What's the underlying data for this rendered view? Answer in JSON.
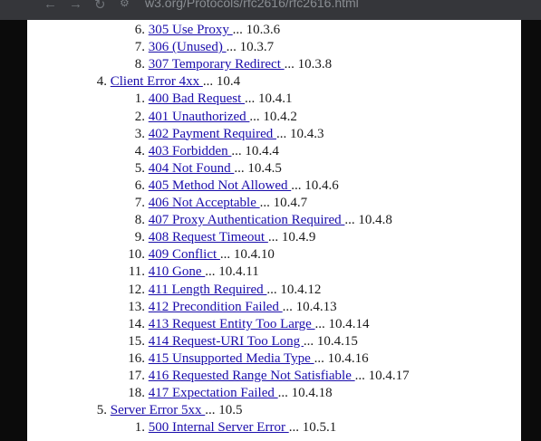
{
  "browser": {
    "url": "w3.org/Protocols/rfc2616/rfc2616.html",
    "back_icon": "←",
    "forward_icon": "→",
    "reload_icon": "↻"
  },
  "toc": [
    {
      "level": 2,
      "num": "6.",
      "link": "305 Use Proxy ",
      "tail": "... 10.3.6"
    },
    {
      "level": 2,
      "num": "7.",
      "link": "306 (Unused) ",
      "tail": "... 10.3.7"
    },
    {
      "level": 2,
      "num": "8.",
      "link": "307 Temporary Redirect ",
      "tail": "... 10.3.8"
    },
    {
      "level": 1,
      "num": "4.",
      "link": "Client Error 4xx ",
      "tail": "... 10.4"
    },
    {
      "level": 2,
      "num": "1.",
      "link": "400 Bad Request ",
      "tail": "... 10.4.1"
    },
    {
      "level": 2,
      "num": "2.",
      "link": "401 Unauthorized ",
      "tail": "... 10.4.2"
    },
    {
      "level": 2,
      "num": "3.",
      "link": "402 Payment Required ",
      "tail": "... 10.4.3"
    },
    {
      "level": 2,
      "num": "4.",
      "link": "403 Forbidden ",
      "tail": "... 10.4.4"
    },
    {
      "level": 2,
      "num": "5.",
      "link": "404 Not Found ",
      "tail": "... 10.4.5"
    },
    {
      "level": 2,
      "num": "6.",
      "link": "405 Method Not Allowed ",
      "tail": "... 10.4.6"
    },
    {
      "level": 2,
      "num": "7.",
      "link": "406 Not Acceptable ",
      "tail": "... 10.4.7"
    },
    {
      "level": 2,
      "num": "8.",
      "link": "407 Proxy Authentication Required ",
      "tail": "... 10.4.8"
    },
    {
      "level": 2,
      "num": "9.",
      "link": "408 Request Timeout ",
      "tail": "... 10.4.9"
    },
    {
      "level": 2,
      "num": "10.",
      "link": "409 Conflict ",
      "tail": "... 10.4.10"
    },
    {
      "level": 2,
      "num": "11.",
      "link": "410 Gone ",
      "tail": "... 10.4.11"
    },
    {
      "level": 2,
      "num": "12.",
      "link": "411 Length Required ",
      "tail": "... 10.4.12"
    },
    {
      "level": 2,
      "num": "13.",
      "link": "412 Precondition Failed ",
      "tail": "... 10.4.13"
    },
    {
      "level": 2,
      "num": "14.",
      "link": "413 Request Entity Too Large ",
      "tail": "... 10.4.14"
    },
    {
      "level": 2,
      "num": "15.",
      "link": "414 Request-URI Too Long ",
      "tail": "... 10.4.15"
    },
    {
      "level": 2,
      "num": "16.",
      "link": "415 Unsupported Media Type ",
      "tail": "... 10.4.16"
    },
    {
      "level": 2,
      "num": "17.",
      "link": "416 Requested Range Not Satisfiable ",
      "tail": "... 10.4.17"
    },
    {
      "level": 2,
      "num": "18.",
      "link": "417 Expectation Failed ",
      "tail": "... 10.4.18"
    },
    {
      "level": 1,
      "num": "5.",
      "link": "Server Error 5xx ",
      "tail": "... 10.5"
    },
    {
      "level": 2,
      "num": "1.",
      "link": "500 Internal Server Error ",
      "tail": "... 10.5.1"
    }
  ]
}
